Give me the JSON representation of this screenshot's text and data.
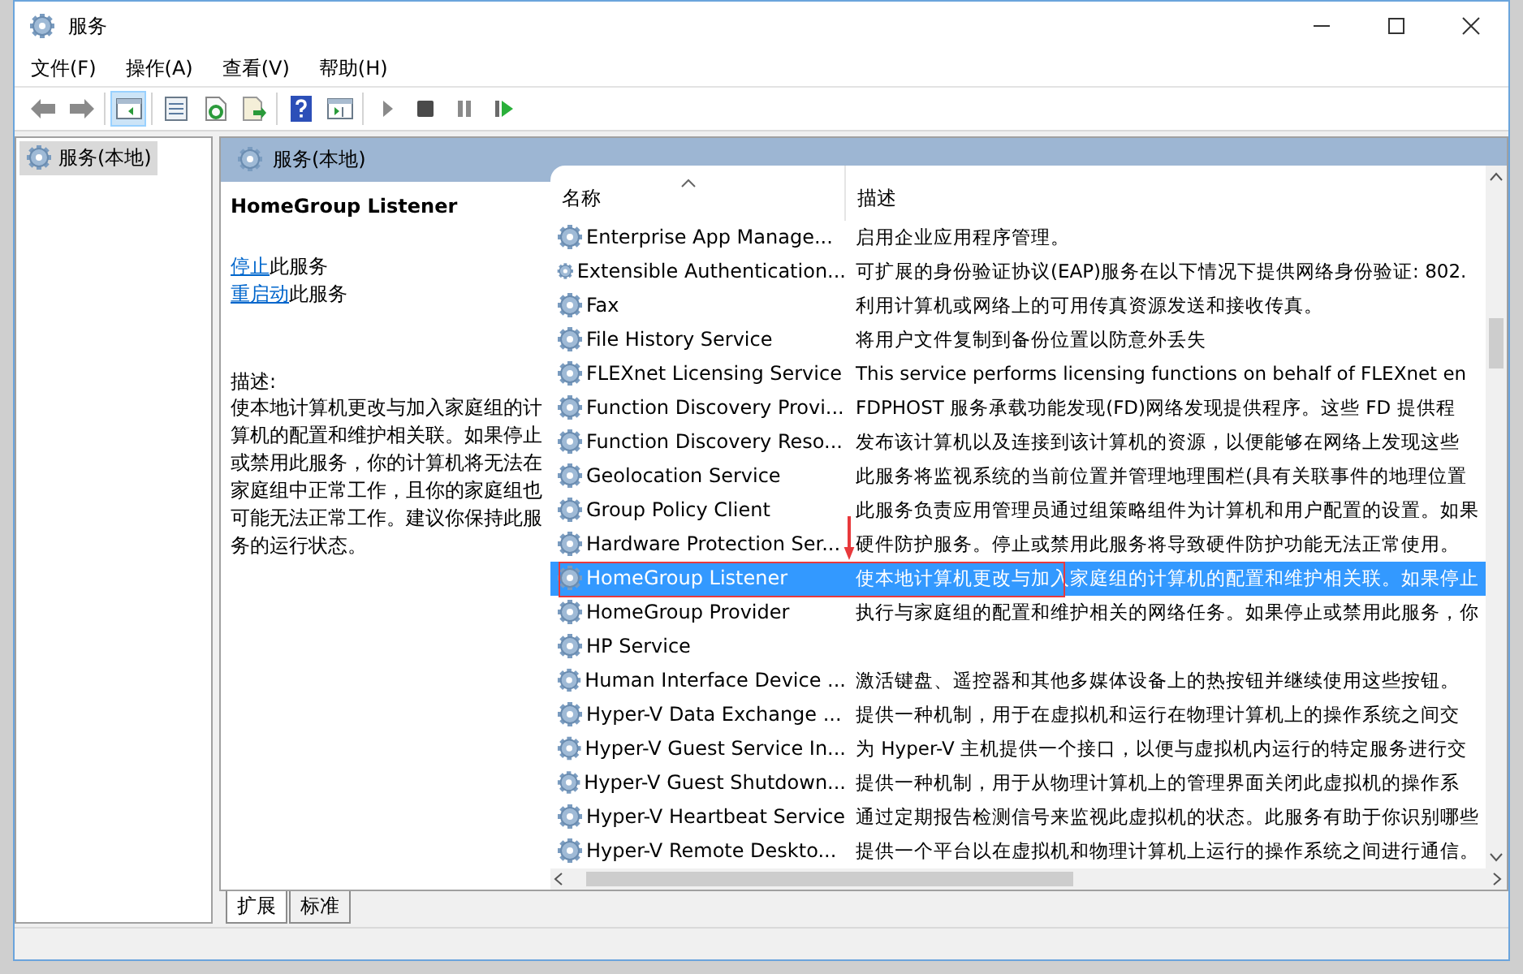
{
  "window": {
    "title": "服务"
  },
  "menu": [
    "文件(F)",
    "操作(A)",
    "查看(V)",
    "帮助(H)"
  ],
  "toolbar": [
    [
      {
        "kind": "back",
        "on": false
      },
      {
        "kind": "forward",
        "on": false
      }
    ],
    [
      {
        "kind": "tree",
        "on": true
      }
    ],
    [
      {
        "kind": "properties",
        "on": false
      },
      {
        "kind": "refresh",
        "on": false
      },
      {
        "kind": "export",
        "on": false
      }
    ],
    [
      {
        "kind": "help",
        "on": false
      },
      {
        "kind": "view",
        "on": false
      }
    ],
    [
      {
        "kind": "play",
        "on": false
      },
      {
        "kind": "stop",
        "on": false
      },
      {
        "kind": "pause",
        "on": false
      },
      {
        "kind": "resume",
        "on": false
      }
    ]
  ],
  "tree": [
    {
      "label": "服务(本地)",
      "selected": true
    }
  ],
  "panel": {
    "title": "服务(本地)"
  },
  "detail": {
    "name": "HomeGroup Listener",
    "actions": [
      {
        "link": "停止",
        "text": "此服务"
      },
      {
        "link": "重启动",
        "text": "此服务"
      }
    ],
    "description_label": "描述:",
    "description": "使本地计算机更改与加入家庭组的计算机的配置和维护相关联。如果停止或禁用此服务，你的计算机将无法在家庭组中正常工作，且你的家庭组也可能无法正常工作。建议你保持此服务的运行状态。"
  },
  "table": {
    "columns": [
      {
        "label": "名称",
        "sorted": true
      },
      {
        "label": "描述",
        "sorted": false
      }
    ],
    "rows": [
      {
        "name": "Enterprise App Manage...",
        "description": "启用企业应用程序管理。",
        "selected": false
      },
      {
        "name": "Extensible Authentication...",
        "description": "可扩展的身份验证协议(EAP)服务在以下情况下提供网络身份验证: 802.",
        "selected": false
      },
      {
        "name": "Fax",
        "description": "利用计算机或网络上的可用传真资源发送和接收传真。",
        "selected": false
      },
      {
        "name": "File History Service",
        "description": "将用户文件复制到备份位置以防意外丢失",
        "selected": false
      },
      {
        "name": "FLEXnet Licensing Service",
        "description": "This service performs licensing functions on behalf of FLEXnet en",
        "selected": false
      },
      {
        "name": "Function Discovery Provi...",
        "description": "FDPHOST 服务承载功能发现(FD)网络发现提供程序。这些 FD 提供程",
        "selected": false
      },
      {
        "name": "Function Discovery Reso...",
        "description": "发布该计算机以及连接到该计算机的资源，以便能够在网络上发现这些",
        "selected": false
      },
      {
        "name": "Geolocation Service",
        "description": "此服务将监视系统的当前位置并管理地理围栏(具有关联事件的地理位置",
        "selected": false
      },
      {
        "name": "Group Policy Client",
        "description": "此服务负责应用管理员通过组策略组件为计算机和用户配置的设置。如果",
        "selected": false
      },
      {
        "name": "Hardware Protection Ser...",
        "description": "硬件防护服务。停止或禁用此服务将导致硬件防护功能无法正常使用。",
        "selected": false
      },
      {
        "name": "HomeGroup Listener",
        "description": "使本地计算机更改与加入家庭组的计算机的配置和维护相关联。如果停止",
        "selected": true
      },
      {
        "name": "HomeGroup Provider",
        "description": "执行与家庭组的配置和维护相关的网络任务。如果停止或禁用此服务，你",
        "selected": false
      },
      {
        "name": "HP Service",
        "selected": false
      },
      {
        "name": "Human Interface Device ...",
        "description": "激活键盘、遥控器和其他多媒体设备上的热按钮并继续使用这些按钮。",
        "selected": false
      },
      {
        "name": "Hyper-V Data Exchange ...",
        "description": "提供一种机制，用于在虚拟机和运行在物理计算机上的操作系统之间交",
        "selected": false
      },
      {
        "name": "Hyper-V Guest Service In...",
        "description": "为 Hyper-V 主机提供一个接口，以便与虚拟机内运行的特定服务进行交",
        "selected": false
      },
      {
        "name": "Hyper-V Guest Shutdown...",
        "description": "提供一种机制，用于从物理计算机上的管理界面关闭此虚拟机的操作系",
        "selected": false
      },
      {
        "name": "Hyper-V Heartbeat Service",
        "description": "通过定期报告检测信号来监视此虚拟机的状态。此服务有助于你识别哪些",
        "selected": false
      },
      {
        "name": "Hyper-V Remote Deskto...",
        "description": "提供一个平台以在虚拟机和物理计算机上运行的操作系统之间进行通信。",
        "selected": false
      }
    ]
  },
  "tabs": [
    {
      "label": "扩展",
      "selected": true
    },
    {
      "label": "标准",
      "selected": false
    }
  ],
  "annotation": {
    "highlight_box": true,
    "arrow": true
  }
}
